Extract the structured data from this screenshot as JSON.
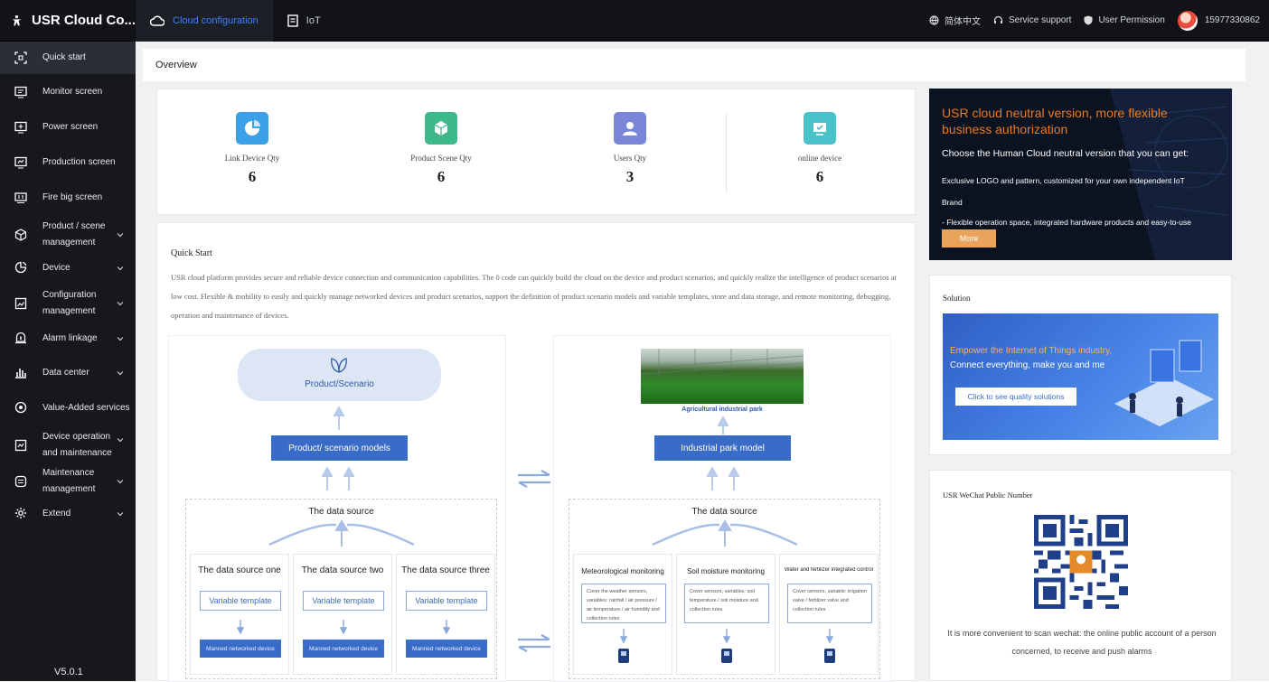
{
  "app": {
    "title": "USR Cloud Co..."
  },
  "header": {
    "tabs": [
      {
        "label": "Cloud configuration",
        "icon": "cloud-icon",
        "active": true
      },
      {
        "label": "IoT",
        "icon": "document-icon",
        "active": false
      }
    ],
    "language": "简体中文",
    "service_support": "Service support",
    "user_permission": "User Permission",
    "account": "15977330862"
  },
  "sidebar": {
    "items": [
      {
        "label": "Quick start",
        "icon": "quick-start-icon"
      },
      {
        "label": "Monitor screen",
        "icon": "monitor-icon"
      },
      {
        "label": "Power screen",
        "icon": "power-screen-icon"
      },
      {
        "label": "Production screen",
        "icon": "production-screen-icon"
      },
      {
        "label": "Fire big screen",
        "icon": "fire-screen-icon"
      },
      {
        "label": "Product / scene management",
        "icon": "cube-icon"
      },
      {
        "label": "Device",
        "icon": "device-icon"
      },
      {
        "label": "Configuration management",
        "icon": "configuration-icon"
      },
      {
        "label": "Alarm linkage",
        "icon": "alarm-icon"
      },
      {
        "label": "Data center",
        "icon": "bar-chart-icon"
      },
      {
        "label": "Value-Added services",
        "icon": "value-added-icon"
      },
      {
        "label": "Device operation and maintenance",
        "icon": "maintenance-icon"
      },
      {
        "label": "Maintenance management",
        "icon": "list-icon"
      },
      {
        "label": "Extend",
        "icon": "gear-icon"
      }
    ],
    "version": "V5.0.1"
  },
  "overview": {
    "title": "Overview"
  },
  "stats": [
    {
      "label": "Link Device Qty",
      "value": "6",
      "color": "#3aa0e8",
      "icon": "pie-chart-icon"
    },
    {
      "label": "Product Scene Qty",
      "value": "6",
      "color": "#3cb88a",
      "icon": "cube-icon"
    },
    {
      "label": "Users Qty",
      "value": "3",
      "color": "#7a86d8",
      "icon": "user-icon"
    },
    {
      "label": "online device",
      "value": "6",
      "color": "#49c2c9",
      "icon": "monitor-check-icon"
    }
  ],
  "quick_start": {
    "title": "Quick Start",
    "description": "USR cloud platform provides secure and reliable device connection and communication capabilities. The 0 code can quickly build the cloud on the device and product scenarios, and quickly realize the intelligence of product scenarios at low cost. Flexible & mobility to easily and quickly manage networked devices and product scenarios, support the definition of product scenario models and variable templates, store and data storage, and remote monitoring, debugging, operation and maintenance of devices."
  },
  "flow_left": {
    "product_label": "Product/Scenario",
    "model_label": "Product/ scenario models",
    "data_source_title": "The data source",
    "sources": [
      {
        "title": "The data source one",
        "template": "Variable template",
        "device": "Manned networked device"
      },
      {
        "title": "The data source two",
        "template": "Variable template",
        "device": "Manned networked device"
      },
      {
        "title": "The data source three",
        "template": "Variable template",
        "device": "Manned networked device"
      }
    ]
  },
  "flow_right": {
    "park_caption": "Agricultural industrial park",
    "model_label": "Industrial park model",
    "data_source_title": "The data source",
    "sources": [
      {
        "title": "Meteorological monitoring",
        "text": "Cover the weather sensors, variables: rainfall / air pressure / air temperature / air humidity and collection rules"
      },
      {
        "title": "Soil moisture monitoring",
        "text": "Cover sensors, variables: soil temperature / soil moisture and collection rules"
      },
      {
        "title": "Water and fertilizer integrated control",
        "text": "Cover sensors, variable: irrigation valve / fertilizer valve and collection rules"
      }
    ]
  },
  "promo": {
    "title": "USR cloud neutral version, more flexible business authorization",
    "subtitle": "Choose the Human Cloud neutral version that you can get:",
    "line1": "Exclusive LOGO and pattern, customized for your own independent IoT",
    "line2": "Brand",
    "line3": "- Flexible operation space, integrated hardware products and easy-to-use",
    "button": "More"
  },
  "solution": {
    "title": "Solution",
    "line1": "Empower the Internet of Things industry,",
    "line2": "Connect everything, make you and me",
    "button": "Click to see quality solutions"
  },
  "wechat": {
    "title": "USR WeChat Public Number",
    "description": "It is more convenient to scan wechat: the online public account of a person concerned, to receive and push alarms"
  }
}
